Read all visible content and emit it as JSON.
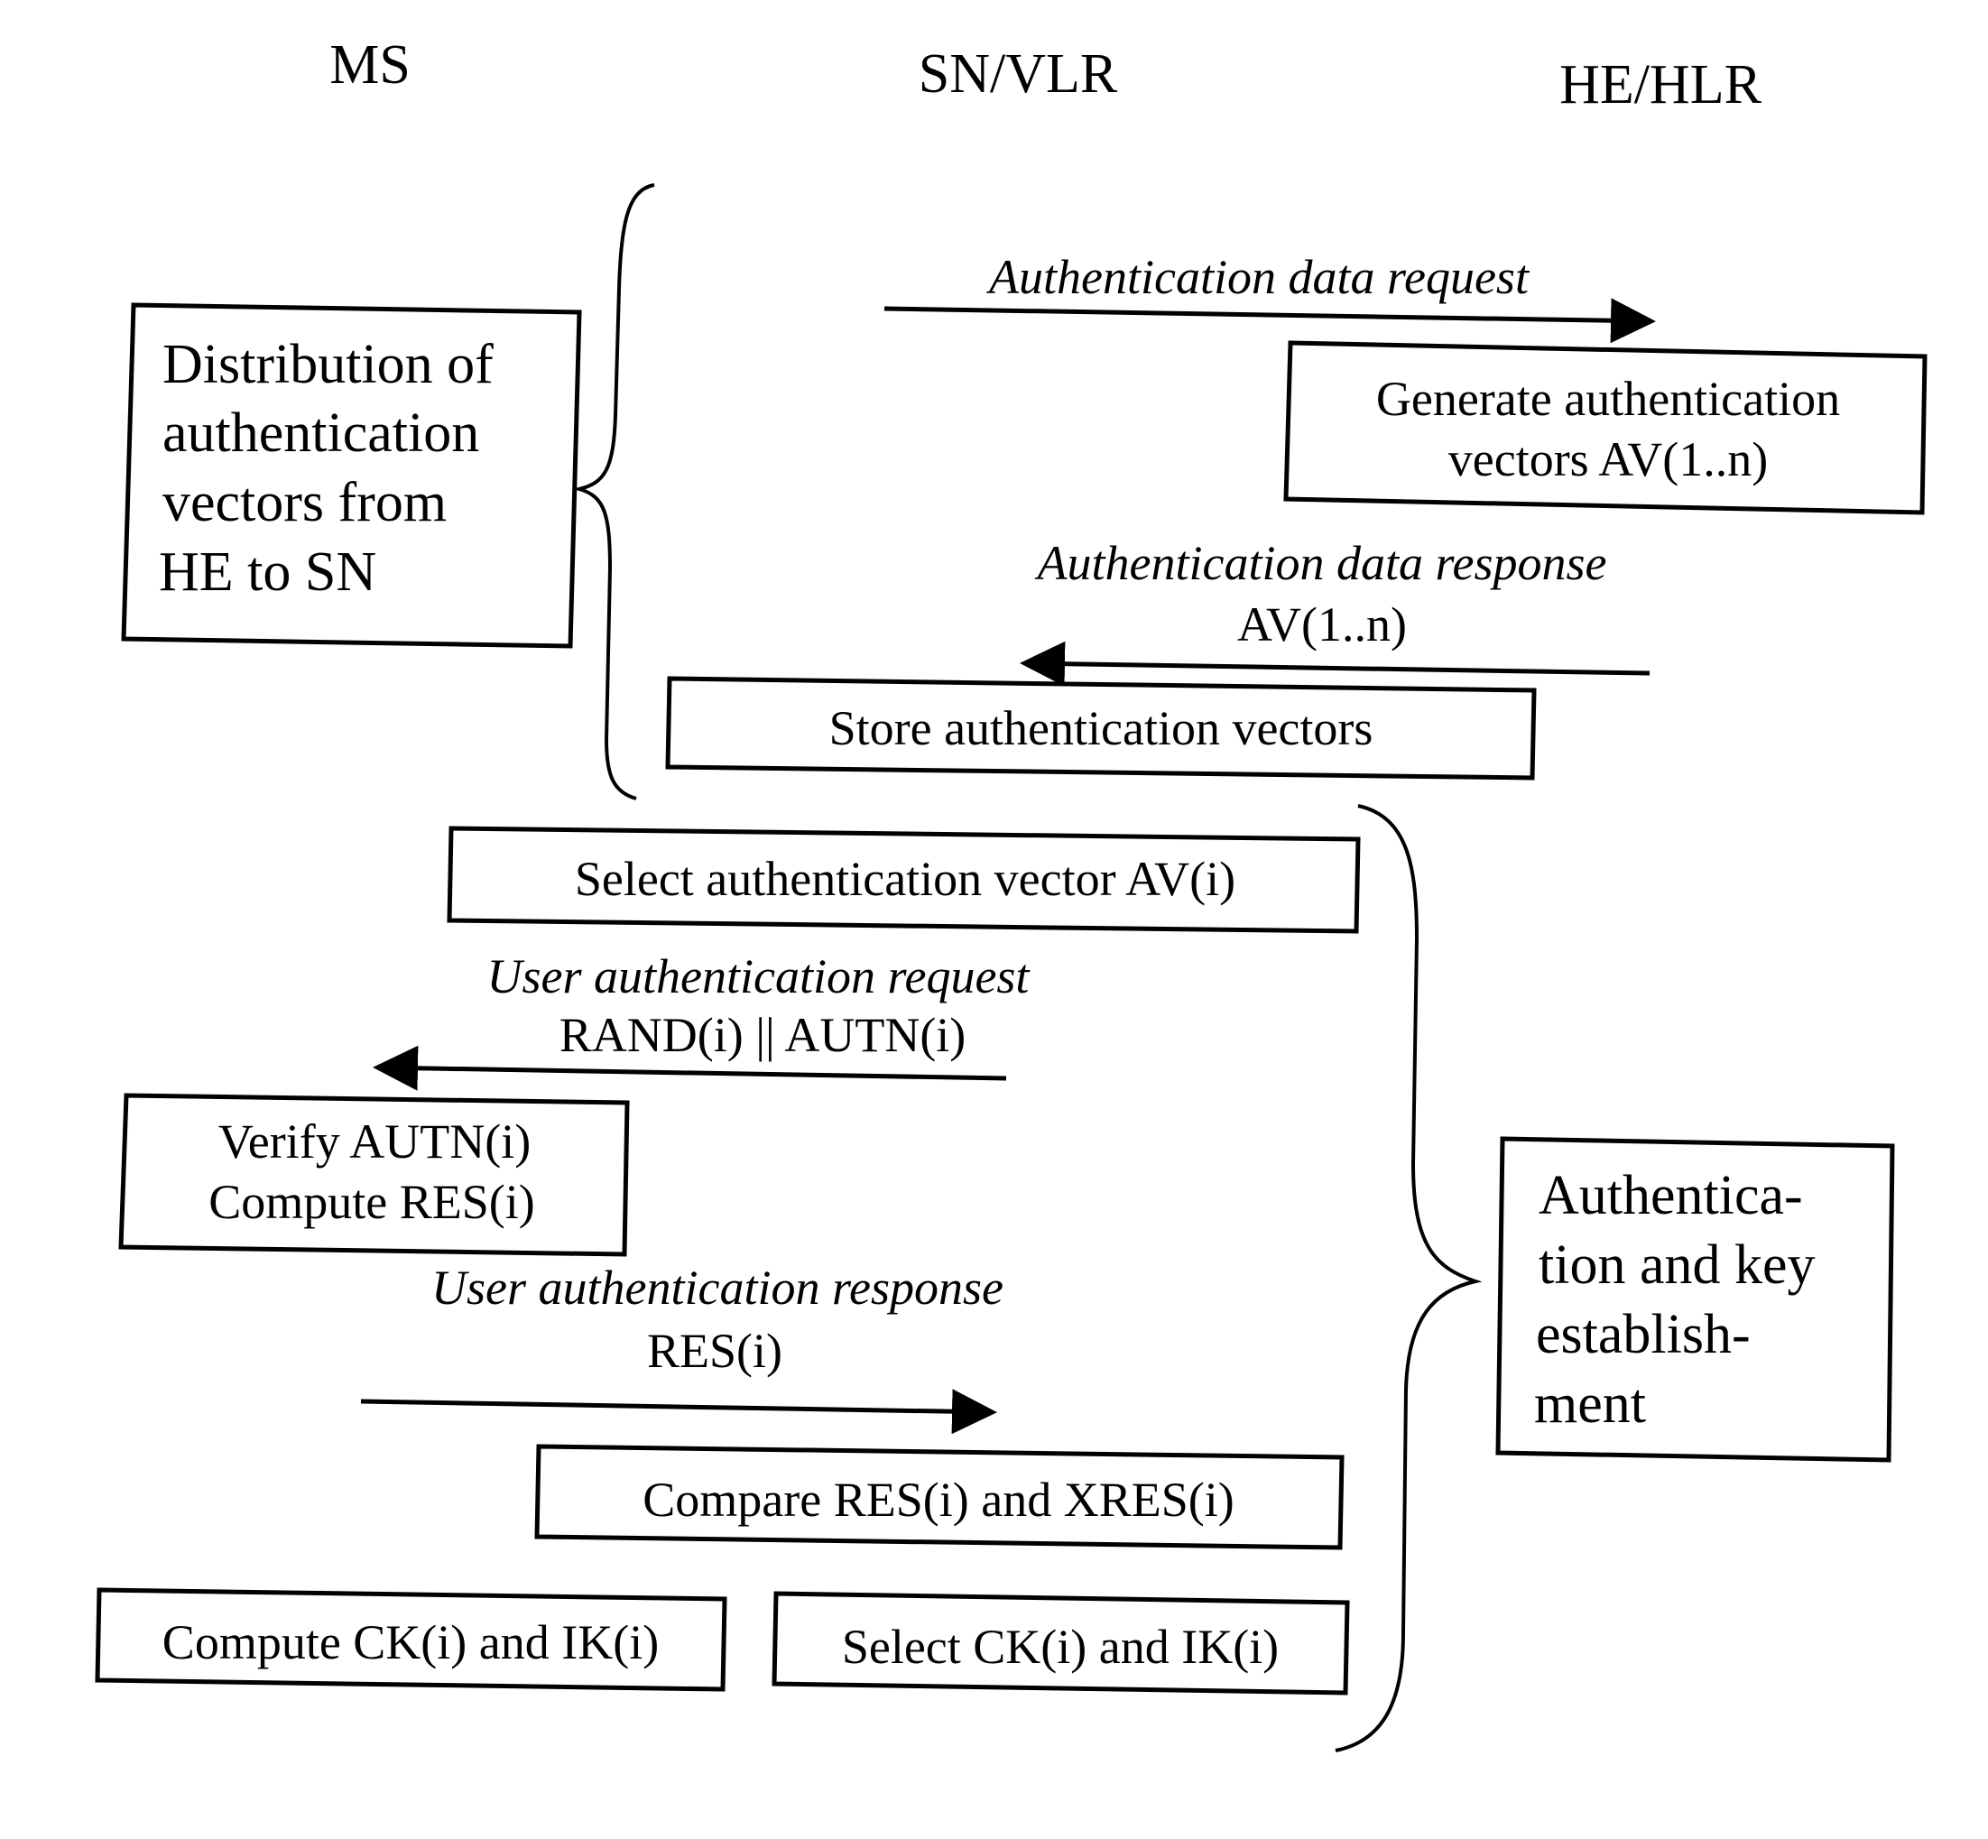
{
  "entities": [
    "MS",
    "SN/VLR",
    "HE/HLR"
  ],
  "phases": {
    "distribution": [
      "Distribution of",
      "authentication",
      "vectors  from",
      "HE to SN"
    ],
    "authentication": [
      "Authentica-",
      "tion and key",
      "establish-",
      "ment"
    ]
  },
  "messages": {
    "auth_data_request": {
      "label": "Authentication data request",
      "from": "SN/VLR",
      "to": "HE/HLR"
    },
    "auth_data_response": {
      "label": "Authentication data response",
      "param": "AV(1..n)",
      "from": "HE/HLR",
      "to": "SN/VLR"
    },
    "user_auth_request": {
      "label": "User authentication request",
      "param": "RAND(i) || AUTN(i)",
      "from": "SN/VLR",
      "to": "MS"
    },
    "user_auth_response": {
      "label": "User authentication response",
      "param": "RES(i)",
      "from": "MS",
      "to": "SN/VLR"
    }
  },
  "steps": {
    "generate": [
      "Generate authentication",
      "vectors AV(1..n)"
    ],
    "store": "Store authentication vectors",
    "select_av": "Select authentication vector AV(i)",
    "verify": [
      "Verify AUTN(i)",
      "Compute RES(i)"
    ],
    "compare": "Compare RES(i) and XRES(i)",
    "compute_keys": "Compute CK(i) and IK(i)",
    "select_keys": "Select CK(i) and IK(i)"
  }
}
